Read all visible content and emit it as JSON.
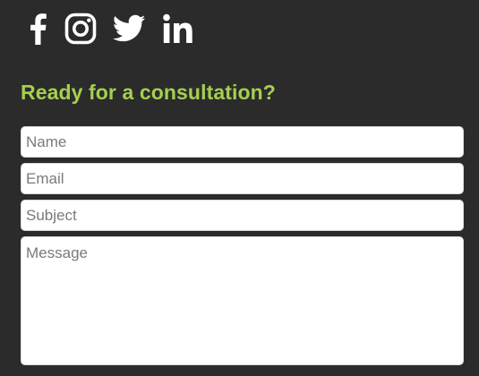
{
  "social": {
    "items": [
      {
        "name": "facebook-icon",
        "label": "Facebook"
      },
      {
        "name": "instagram-icon",
        "label": "Instagram"
      },
      {
        "name": "twitter-icon",
        "label": "Twitter"
      },
      {
        "name": "linkedin-icon",
        "label": "LinkedIn"
      }
    ],
    "icon_color": "#ffffff"
  },
  "contact_form": {
    "heading": "Ready for a consultation?",
    "heading_color": "#a6cf4f",
    "fields": {
      "name": {
        "placeholder": "Name",
        "value": ""
      },
      "email": {
        "placeholder": "Email",
        "value": ""
      },
      "subject": {
        "placeholder": "Subject",
        "value": ""
      },
      "message": {
        "placeholder": "Message",
        "value": ""
      }
    }
  },
  "colors": {
    "background": "#2b2b2b",
    "field_background": "#ffffff",
    "placeholder": "#7a7a7a"
  }
}
